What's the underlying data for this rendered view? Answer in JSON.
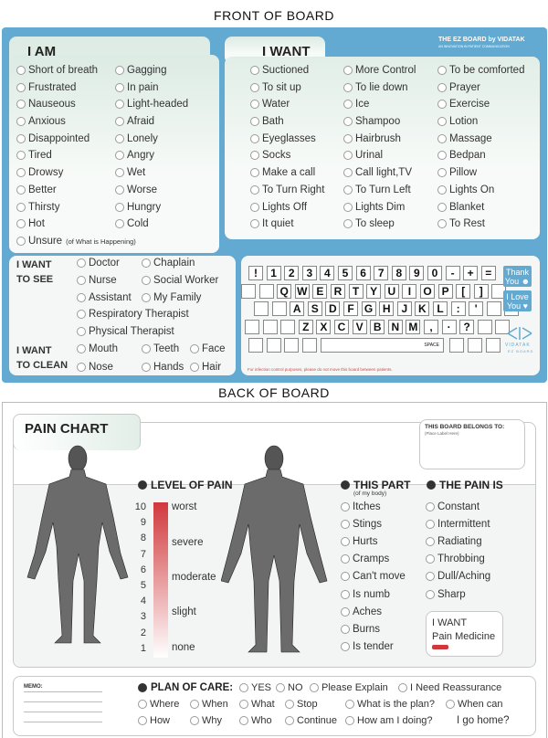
{
  "front": {
    "title": "FRONT OF BOARD",
    "brand": "THE EZ BOARD by VIDATAK",
    "tagline": "AN INNOVATION IN PATIENT COMMUNICATION",
    "i_am": {
      "heading": "I AM",
      "columns": [
        [
          "Short of breath",
          "Frustrated",
          "Nauseous",
          "Anxious",
          "Disappointed",
          "Tired",
          "Drowsy",
          "Better",
          "Thirsty",
          "Hot"
        ],
        [
          "Gagging",
          "In pain",
          "Light-headed",
          "Afraid",
          "Lonely",
          "Angry",
          "Wet",
          "Worse",
          "Hungry",
          "Cold"
        ]
      ],
      "unsure": "Unsure",
      "unsure_note": "(of What is Happening)"
    },
    "i_want": {
      "heading": "I WANT",
      "columns": [
        [
          "Suctioned",
          "To sit up",
          "Water",
          "Bath",
          "Eyeglasses",
          "Socks",
          "Make a call",
          "To Turn Right",
          "Lights Off",
          "It quiet"
        ],
        [
          "More Control",
          "To lie down",
          "Ice",
          "Shampoo",
          "Hairbrush",
          "Urinal",
          "Call light,TV",
          "To Turn Left",
          "Lights Dim",
          "To sleep"
        ],
        [
          "To be comforted",
          "Prayer",
          "Exercise",
          "Lotion",
          "Massage",
          "Bedpan",
          "Pillow",
          "Lights On",
          "Blanket",
          "To Rest"
        ]
      ]
    },
    "see": {
      "label": [
        "I WANT",
        "TO SEE"
      ],
      "items": [
        "Doctor",
        "Chaplain",
        "Nurse",
        "Social Worker",
        "Assistant",
        "My Family",
        "Respiratory Therapist",
        "Physical Therapist"
      ]
    },
    "clean": {
      "label": [
        "I WANT",
        "TO CLEAN"
      ],
      "items": [
        "Mouth",
        "Teeth",
        "Face",
        "Nose",
        "Hands",
        "Hair"
      ]
    },
    "keyboard": {
      "rows": [
        [
          "!",
          "1",
          "2",
          "3",
          "4",
          "5",
          "6",
          "7",
          "8",
          "9",
          "0",
          "-",
          "+",
          "="
        ],
        [
          "",
          "",
          "Q",
          "W",
          "E",
          "R",
          "T",
          "Y",
          "U",
          "I",
          "O",
          "P",
          "[",
          "]",
          ""
        ],
        [
          "",
          "",
          "A",
          "S",
          "D",
          "F",
          "G",
          "H",
          "J",
          "K",
          "L",
          ":",
          "'",
          "",
          ""
        ],
        [
          "",
          "",
          "",
          "Z",
          "X",
          "C",
          "V",
          "B",
          "N",
          "M",
          ",",
          "·",
          "?",
          "",
          ""
        ],
        [
          "",
          "",
          "",
          ""
        ]
      ],
      "row5_right": [
        "",
        "",
        ""
      ],
      "space": "SPACE"
    },
    "thank_you": [
      "Thank",
      "You ☻"
    ],
    "love_you": [
      "I Love",
      "You ♥"
    ],
    "logo": {
      "name": "VIDATAK",
      "sub": "EZ BOARD"
    },
    "notice": "For infection control purposes, please do not move this board between patients."
  },
  "back": {
    "title": "BACK OF BOARD",
    "pain_chart": "PAIN CHART",
    "belongs": "THIS BOARD BELONGS TO:",
    "belongs_placeholder": "(Place Label Here)",
    "level": {
      "heading": "LEVEL OF PAIN",
      "numbers": [
        "10",
        "9",
        "8",
        "7",
        "6",
        "5",
        "4",
        "3",
        "2",
        "1"
      ],
      "labels": [
        "worst",
        "severe",
        "moderate",
        "slight",
        "none"
      ],
      "color": "#d0383c"
    },
    "this_part": {
      "heading": "THIS PART",
      "sub": "(of my body)",
      "items": [
        "Itches",
        "Stings",
        "Hurts",
        "Cramps",
        "Can't move",
        "Is numb",
        "Aches",
        "Burns",
        "Is tender"
      ]
    },
    "pain_is": {
      "heading": "THE PAIN IS",
      "items": [
        "Constant",
        "Intermittent",
        "Radiating",
        "Throbbing",
        "Dull/Aching",
        "Sharp"
      ]
    },
    "want_box": {
      "line1": "I WANT",
      "line2": "Pain Medicine"
    },
    "memo": "MEMO:",
    "plan": {
      "heading": "PLAN OF CARE:",
      "row1": [
        "YES",
        "NO",
        "Please Explain",
        "I Need Reassurance"
      ],
      "row2": [
        "Where",
        "When",
        "What",
        "Stop",
        "What is the plan?",
        "When can"
      ],
      "row3": [
        "How",
        "Why",
        "Who",
        "Continue",
        "How am I doing?"
      ],
      "row3_tail": "I go home?"
    }
  }
}
